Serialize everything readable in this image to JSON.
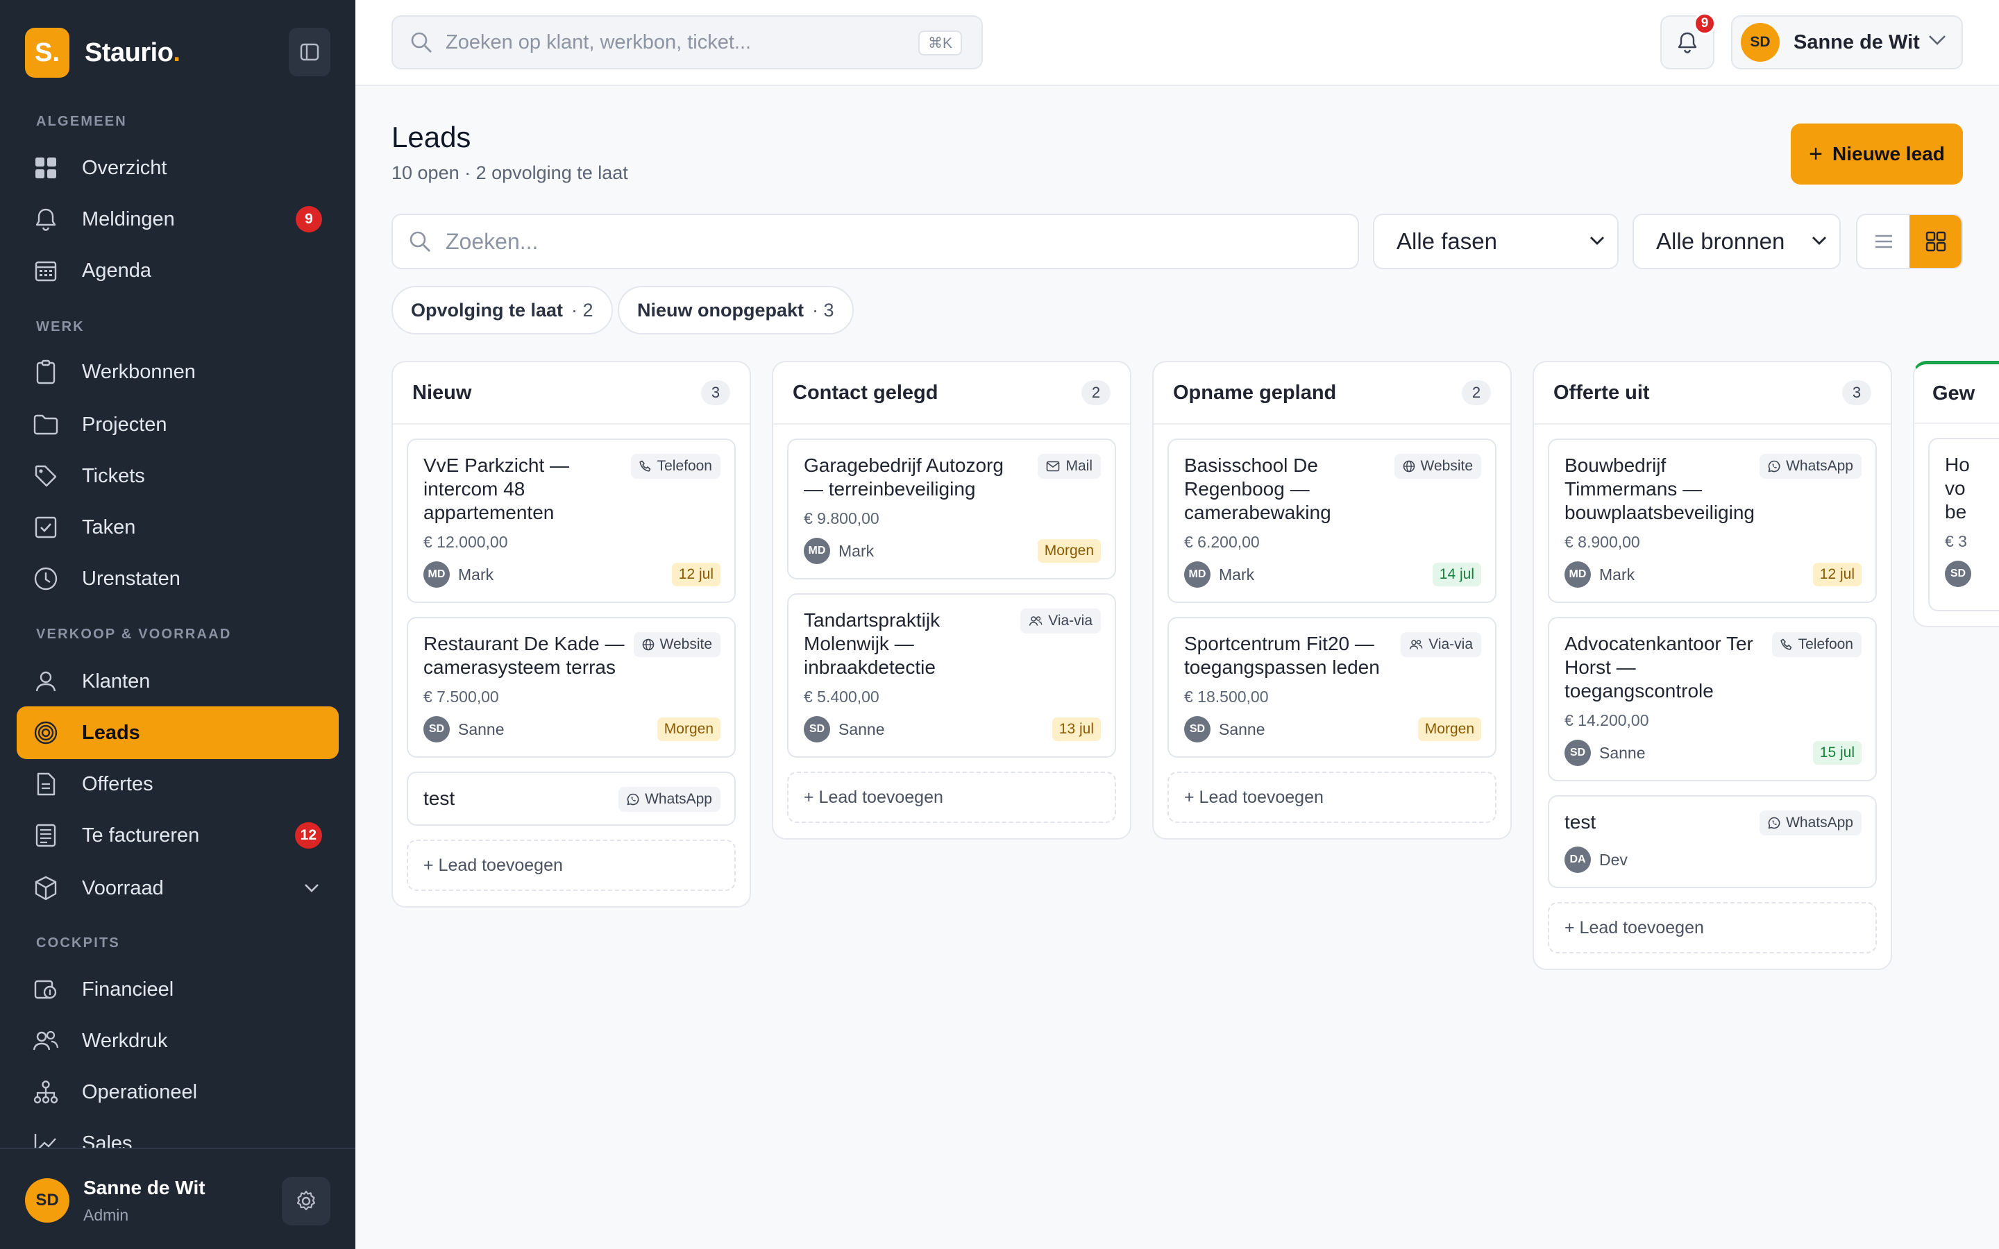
{
  "brand": {
    "logo_letter": "S.",
    "name": "Staurio",
    "dot": "."
  },
  "sidebar": {
    "sections": [
      {
        "label": "ALGEMEEN"
      },
      {
        "label": "WERK"
      },
      {
        "label": "VERKOOP & VOORRAAD"
      },
      {
        "label": "COCKPITS"
      }
    ],
    "items": [
      {
        "label": "Overzicht",
        "icon": "grid-icon"
      },
      {
        "label": "Meldingen",
        "icon": "bell-icon",
        "badge": "9"
      },
      {
        "label": "Agenda",
        "icon": "calendar-icon"
      },
      {
        "label": "Werkbonnen",
        "icon": "clipboard-icon"
      },
      {
        "label": "Projecten",
        "icon": "folder-icon"
      },
      {
        "label": "Tickets",
        "icon": "tag-icon"
      },
      {
        "label": "Taken",
        "icon": "checkbox-icon"
      },
      {
        "label": "Urenstaten",
        "icon": "clock-icon"
      },
      {
        "label": "Klanten",
        "icon": "user-icon"
      },
      {
        "label": "Leads",
        "icon": "target-icon",
        "active": true
      },
      {
        "label": "Offertes",
        "icon": "document-icon"
      },
      {
        "label": "Te factureren",
        "icon": "invoice-icon",
        "badge": "12"
      },
      {
        "label": "Voorraad",
        "icon": "box-icon"
      },
      {
        "label": "Financieel",
        "icon": "finance-icon"
      },
      {
        "label": "Werkdruk",
        "icon": "users-icon"
      },
      {
        "label": "Operationeel",
        "icon": "hierarchy-icon"
      },
      {
        "label": "Sales",
        "icon": "chart-icon"
      }
    ],
    "footer": {
      "initials": "SD",
      "name": "Sanne de Wit",
      "role": "Admin"
    }
  },
  "topbar": {
    "search_placeholder": "Zoeken op klant, werkbon, ticket...",
    "shortcut": "⌘K",
    "notifications_count": "9",
    "user": {
      "initials": "SD",
      "name": "Sanne de Wit"
    }
  },
  "page": {
    "title": "Leads",
    "subtitle": "10 open · 2 opvolging te laat",
    "new_button": "Nieuwe lead",
    "search_placeholder": "Zoeken...",
    "filter_phase": "Alle fasen",
    "filter_source": "Alle bronnen",
    "chips": [
      {
        "label": "Opvolging te laat",
        "count": "· 2"
      },
      {
        "label": "Nieuw onopgepakt",
        "count": "· 3"
      }
    ]
  },
  "board": {
    "add_label": "+ Lead toevoegen",
    "columns": [
      {
        "title": "Nieuw",
        "count": "3",
        "cards": [
          {
            "title": "VvE Parkzicht — intercom 48 appartementen",
            "source": "Telefoon",
            "amount": "€ 12.000,00",
            "initials": "MD",
            "owner": "Mark",
            "due": "12 jul"
          },
          {
            "title": "Restaurant De Kade — camerasysteem terras",
            "source": "Website",
            "amount": "€ 7.500,00",
            "initials": "SD",
            "owner": "Sanne",
            "due": "Morgen"
          },
          {
            "title": "test",
            "source": "WhatsApp"
          }
        ]
      },
      {
        "title": "Contact gelegd",
        "count": "2",
        "cards": [
          {
            "title": "Garagebedrijf Autozorg — terreinbeveiliging",
            "source": "Mail",
            "amount": "€ 9.800,00",
            "initials": "MD",
            "owner": "Mark",
            "due": "Morgen"
          },
          {
            "title": "Tandartspraktijk Molenwijk — inbraakdetectie",
            "source": "Via-via",
            "amount": "€ 5.400,00",
            "initials": "SD",
            "owner": "Sanne",
            "due": "13 jul"
          }
        ]
      },
      {
        "title": "Opname gepland",
        "count": "2",
        "cards": [
          {
            "title": "Basisschool De Regenboog — camerabewaking",
            "source": "Website",
            "amount": "€ 6.200,00",
            "initials": "MD",
            "owner": "Mark",
            "due": "14 jul"
          },
          {
            "title": "Sportcentrum Fit20 — toegangspassen leden",
            "source": "Via-via",
            "amount": "€ 18.500,00",
            "initials": "SD",
            "owner": "Sanne",
            "due": "Morgen"
          }
        ]
      },
      {
        "title": "Offerte uit",
        "count": "3",
        "cards": [
          {
            "title": "Bouwbedrijf Timmermans — bouwplaatsbeveiliging",
            "source": "WhatsApp",
            "amount": "€ 8.900,00",
            "initials": "MD",
            "owner": "Mark",
            "due": "12 jul"
          },
          {
            "title": "Advocatenkantoor Ter Horst — toegangscontrole",
            "source": "Telefoon",
            "amount": "€ 14.200,00",
            "initials": "SD",
            "owner": "Sanne",
            "due": "15 jul"
          },
          {
            "title": "test",
            "source": "WhatsApp",
            "initials": "DA",
            "owner": "Dev"
          }
        ]
      },
      {
        "title": "Gew",
        "partial": true,
        "cards": [
          {
            "title": "Ho vo be",
            "amount": "€ 3",
            "initials": "SD"
          }
        ]
      }
    ]
  },
  "colors": {
    "accent": "#f59e0b",
    "sidebar_bg": "#1f2733",
    "badge_red": "#dc2626",
    "due_amber_bg": "#fdf0c8",
    "due_green_bg": "#e4f6ea",
    "won_green": "#16a34a"
  }
}
